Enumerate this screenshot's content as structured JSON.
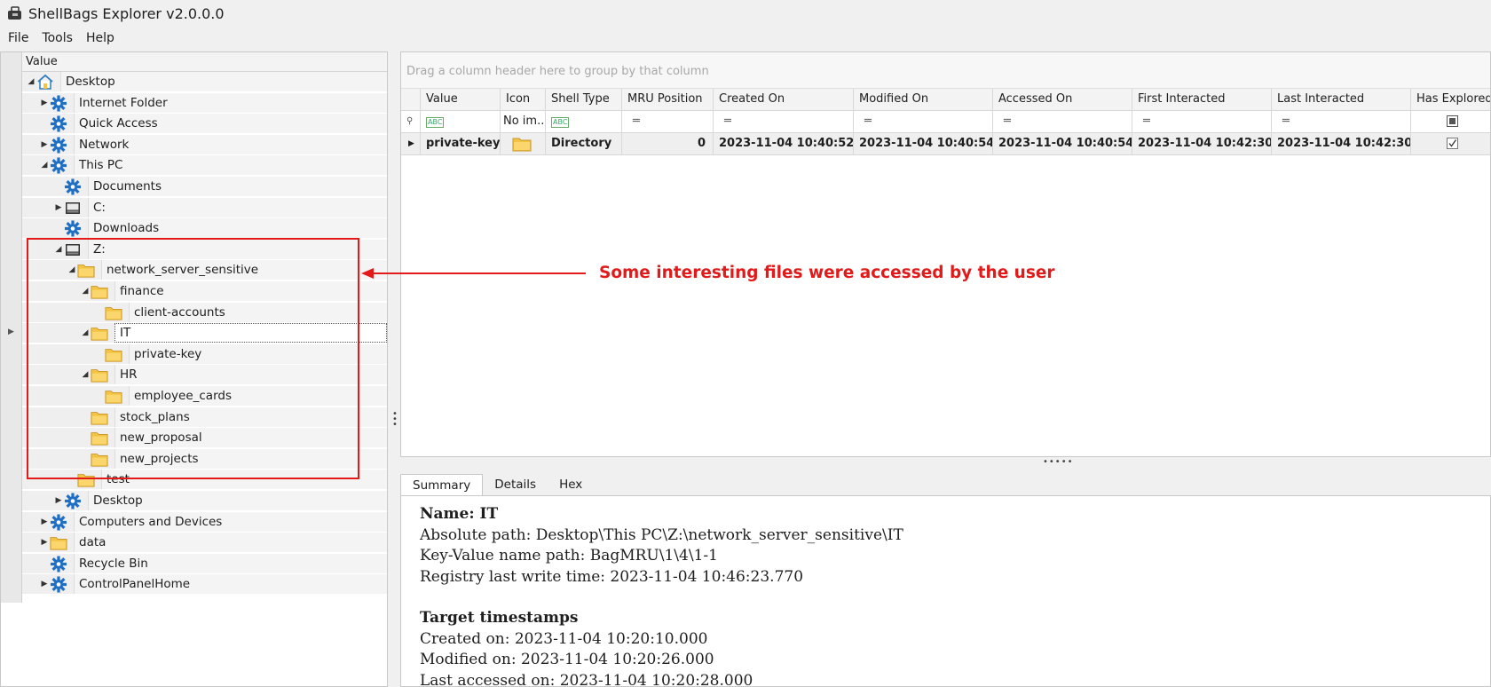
{
  "window": {
    "title": "ShellBags Explorer v2.0.0.0"
  },
  "menu": [
    "File",
    "Tools",
    "Help"
  ],
  "tree": {
    "column_header": "Value",
    "rows": [
      {
        "label": "Desktop",
        "icon": "home-icon",
        "expander": "expanded",
        "depth": 0
      },
      {
        "label": "Internet Folder",
        "icon": "gear-icon",
        "expander": "collapsed",
        "depth": 1
      },
      {
        "label": "Quick Access",
        "icon": "gear-icon",
        "expander": "none",
        "depth": 1
      },
      {
        "label": "Network",
        "icon": "gear-icon",
        "expander": "collapsed",
        "depth": 1
      },
      {
        "label": "This PC",
        "icon": "gear-icon",
        "expander": "expanded",
        "depth": 1
      },
      {
        "label": "Documents",
        "icon": "gear-icon",
        "expander": "none",
        "depth": 2
      },
      {
        "label": "C:",
        "icon": "drive-icon",
        "expander": "collapsed",
        "depth": 2
      },
      {
        "label": "Downloads",
        "icon": "gear-icon",
        "expander": "none",
        "depth": 2
      },
      {
        "label": "Z:",
        "icon": "drive-icon",
        "expander": "expanded",
        "depth": 2
      },
      {
        "label": "network_server_sensitive",
        "icon": "folder-icon",
        "expander": "expanded",
        "depth": 3
      },
      {
        "label": "finance",
        "icon": "folder-icon",
        "expander": "expanded",
        "depth": 4
      },
      {
        "label": "client-accounts",
        "icon": "folder-icon",
        "expander": "none",
        "depth": 5
      },
      {
        "label": "IT",
        "icon": "folder-icon",
        "expander": "expanded",
        "depth": 4,
        "selected": true
      },
      {
        "label": "private-key",
        "icon": "folder-icon",
        "expander": "none",
        "depth": 5
      },
      {
        "label": "HR",
        "icon": "folder-icon",
        "expander": "expanded",
        "depth": 4
      },
      {
        "label": "employee_cards",
        "icon": "folder-icon",
        "expander": "none",
        "depth": 5
      },
      {
        "label": "stock_plans",
        "icon": "folder-icon",
        "expander": "none",
        "depth": 4
      },
      {
        "label": "new_proposal",
        "icon": "folder-icon",
        "expander": "none",
        "depth": 4
      },
      {
        "label": "new_projects",
        "icon": "folder-icon",
        "expander": "none",
        "depth": 4
      },
      {
        "label": "test",
        "icon": "folder-icon",
        "expander": "none",
        "depth": 3
      },
      {
        "label": "Desktop",
        "icon": "gear-icon",
        "expander": "collapsed",
        "depth": 2
      },
      {
        "label": "Computers and Devices",
        "icon": "gear-icon",
        "expander": "collapsed",
        "depth": 1
      },
      {
        "label": "data",
        "icon": "folder-icon",
        "expander": "collapsed",
        "depth": 1
      },
      {
        "label": "Recycle Bin",
        "icon": "gear-icon",
        "expander": "none",
        "depth": 1
      },
      {
        "label": "ControlPanelHome",
        "icon": "gear-icon",
        "expander": "collapsed",
        "depth": 1
      }
    ]
  },
  "grid": {
    "group_hint": "Drag a column header here to group by that column",
    "columns": [
      "Value",
      "Icon",
      "Shell Type",
      "MRU Position",
      "Created On",
      "Modified On",
      "Accessed On",
      "First Interacted",
      "Last Interacted",
      "Has Explored"
    ],
    "filter_row": {
      "icon_filter": "No im..."
    },
    "rows": [
      {
        "value": "private-key",
        "shell_type": "Directory",
        "mru_position": "0",
        "created_on": "2023-11-04 10:40:52",
        "modified_on": "2023-11-04 10:40:54",
        "accessed_on": "2023-11-04 10:40:54",
        "first_interacted": "2023-11-04 10:42:30",
        "last_interacted": "2023-11-04 10:42:30",
        "has_explored": true
      }
    ]
  },
  "tabs": [
    "Summary",
    "Details",
    "Hex"
  ],
  "active_tab": "Summary",
  "summary": {
    "name": "Name: IT",
    "absolute_path": "Absolute path: Desktop\\This PC\\Z:\\network_server_sensitive\\IT",
    "key_value_path": "Key-Value name path: BagMRU\\1\\4\\1-1",
    "registry_write_time": "Registry last write time: 2023-11-04 10:46:23.770",
    "target_heading": "Target timestamps",
    "created": "Created on: 2023-11-04 10:20:10.000",
    "modified": "Modified on: 2023-11-04 10:20:26.000",
    "accessed": "Last accessed on: 2023-11-04 10:20:28.000"
  },
  "annotation": {
    "text": "Some interesting files were accessed by the user",
    "color": "#e21a1a"
  },
  "colors": {
    "gear": "#1f6fc5",
    "folder": "#f3c443",
    "annotation": "#e21a1a"
  }
}
